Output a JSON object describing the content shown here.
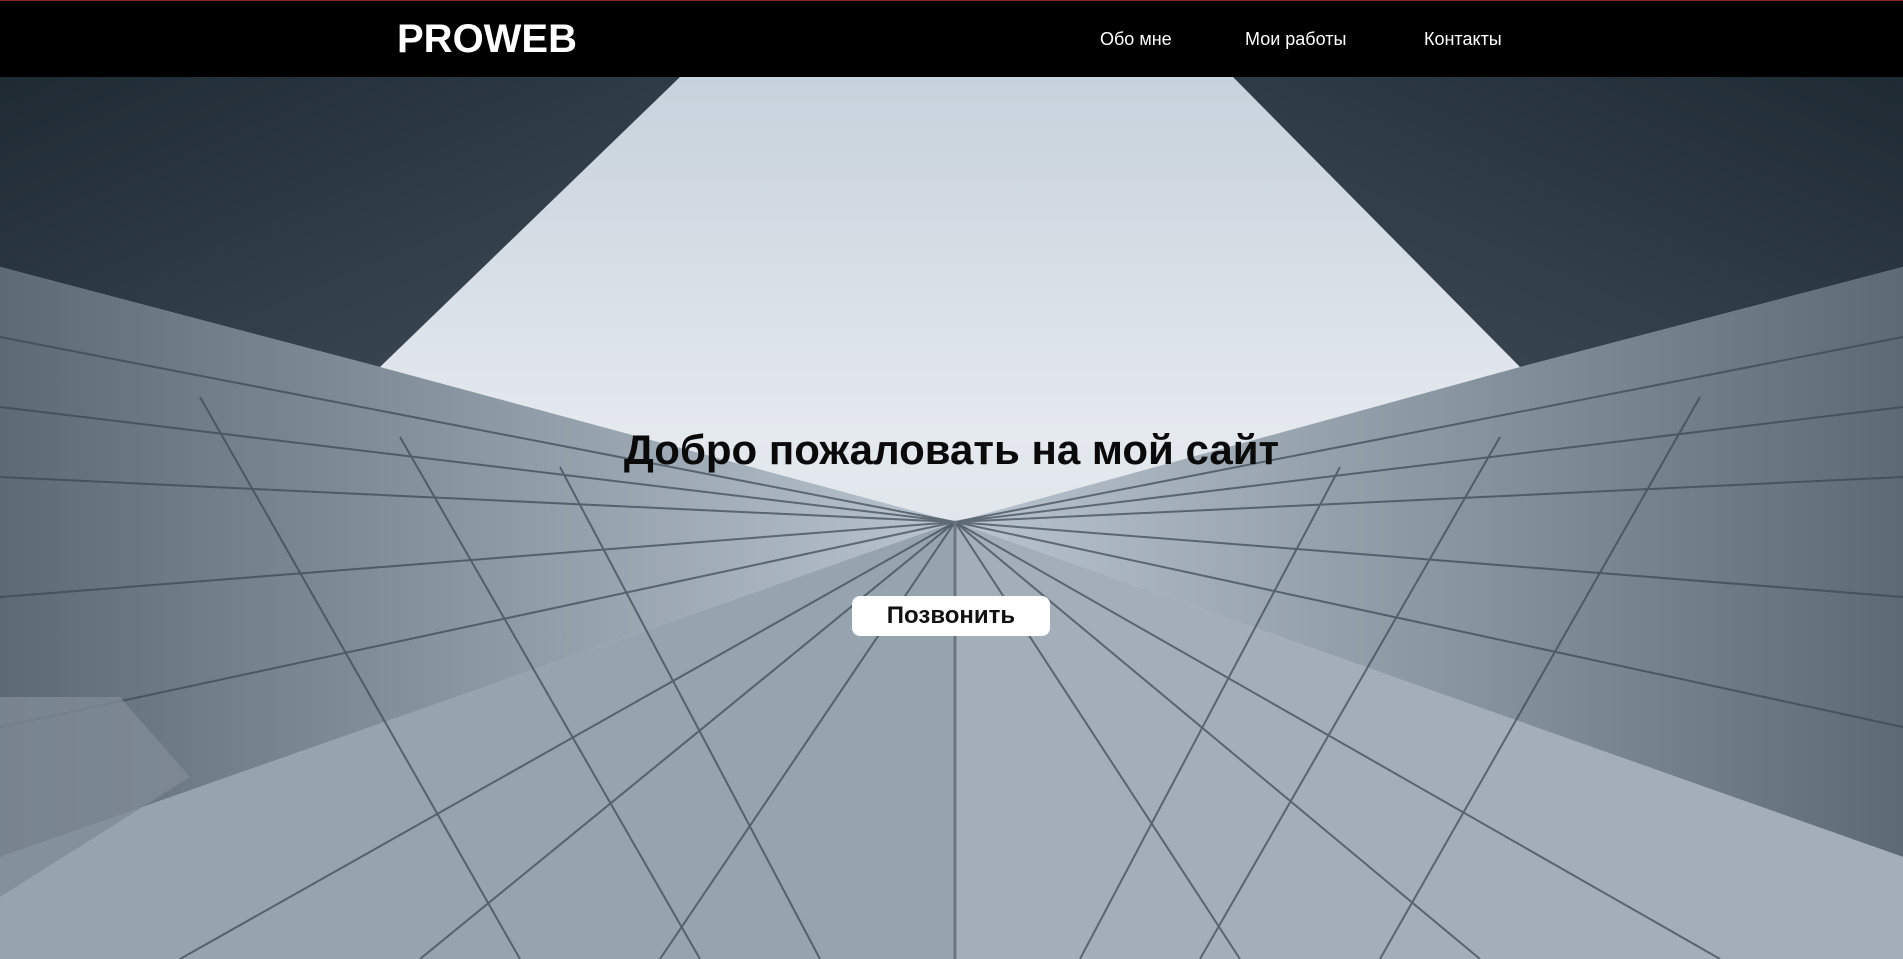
{
  "header": {
    "logo": "PROWEB",
    "nav": [
      {
        "label": "Обо мне"
      },
      {
        "label": "Мои работы"
      },
      {
        "label": "Контакты"
      }
    ]
  },
  "hero": {
    "title": "Добро пожаловать на мой сайт",
    "button_label": "Позвонить",
    "background": "architecture-glass-skyscraper-photo"
  },
  "colors": {
    "header_bg": "#000000",
    "header_text": "#ffffff",
    "accent_line": "#8a2a2a",
    "button_bg": "#ffffff",
    "title_text": "#0a0a0a"
  }
}
